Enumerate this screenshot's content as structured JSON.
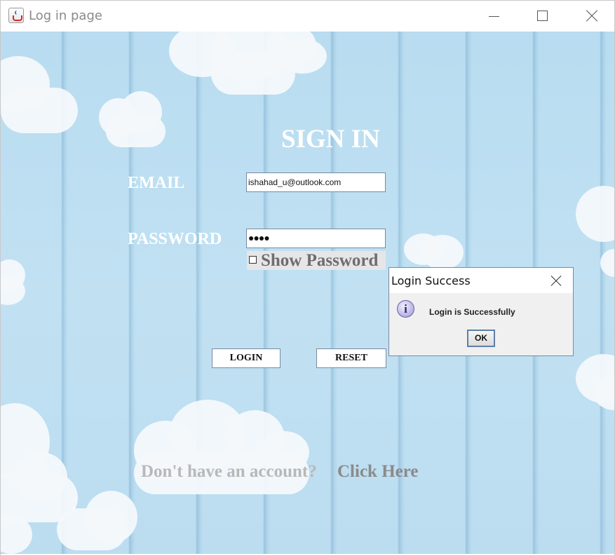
{
  "window": {
    "title": "Log in page"
  },
  "form": {
    "heading": "SIGN IN",
    "email_label": "EMAIL",
    "email_value": "ishahad_u@outlook.com",
    "password_label": "PASSWORD",
    "password_mask": "●●●●",
    "show_password_label": "Show Password",
    "show_password_checked": false,
    "login_label": "LOGIN",
    "reset_label": "RESET",
    "no_account_text": "Don't have an account?",
    "click_here_text": "Click Here"
  },
  "dialog": {
    "title": "Login Success",
    "message": "Login is Successfully",
    "ok_label": "OK",
    "icon": "info-icon"
  },
  "colors": {
    "background": "#bfe0f2",
    "label_text": "#ffffff",
    "link_muted": "#b8b8b8",
    "link_strong": "#8a8a8a"
  }
}
